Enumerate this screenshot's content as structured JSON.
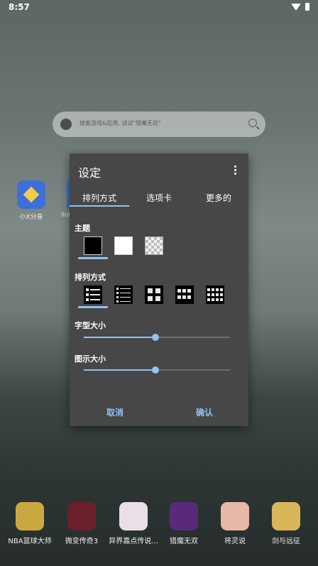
{
  "status_bar": {
    "time": "8:57",
    "wifi_icon": "wifi-icon",
    "battery_icon": "battery-icon"
  },
  "search": {
    "placeholder": "搜索游戏&应用, 试试\"猎魔无双\"",
    "logo_icon": "app-logo-icon",
    "search_icon": "search-icon"
  },
  "home_apps": [
    {
      "label": "小X分身",
      "icon": "diamond-icon",
      "color": "#3c6fd8"
    }
  ],
  "peek_label": "ilor",
  "dialog": {
    "title": "设定",
    "menu_icon": "more-vert-icon",
    "tabs": [
      {
        "label": "排列方式",
        "active": true
      },
      {
        "label": "选项卡"
      },
      {
        "label": "更多的"
      }
    ],
    "theme": {
      "label": "主题",
      "options": [
        "black",
        "white",
        "transparent"
      ],
      "selected": "black"
    },
    "layout": {
      "label": "排列方式",
      "options": [
        "list",
        "compact-list",
        "grid-2",
        "grid-3",
        "grid-4"
      ],
      "selected": "list"
    },
    "font_size": {
      "label": "字型大小",
      "value": 0.49
    },
    "icon_size": {
      "label": "图示大小",
      "value": 0.49
    },
    "cancel_label": "取消",
    "confirm_label": "确认",
    "accent_color": "#8fc3f4"
  },
  "dock": [
    {
      "label": "NBA篮球大师",
      "color": "#c9a93f"
    },
    {
      "label": "微变传奇3",
      "color": "#6b1f2a"
    },
    {
      "label": "异界嘉点传说...",
      "color": "#e8e0e6"
    },
    {
      "label": "猎魔无双",
      "color": "#5a2a7a"
    },
    {
      "label": "将灵说",
      "color": "#e7b7a8"
    },
    {
      "label": "剑与远征",
      "color": "#d7b75a"
    }
  ]
}
